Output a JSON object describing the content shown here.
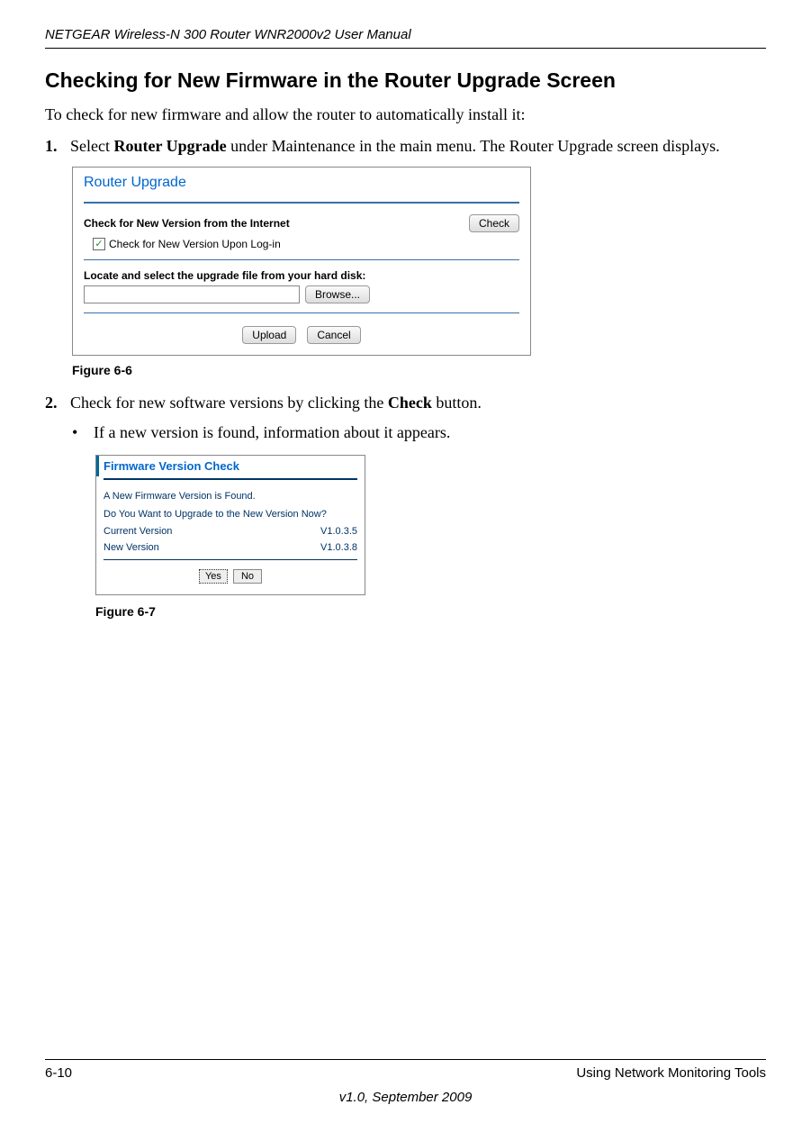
{
  "header": {
    "title": "NETGEAR Wireless-N 300 Router WNR2000v2 User Manual"
  },
  "section": {
    "heading": "Checking for New Firmware in the Router Upgrade Screen",
    "intro": "To check for new firmware and allow the router to automatically install it:"
  },
  "step1": {
    "num": "1.",
    "prefix": "Select ",
    "bold": "Router Upgrade",
    "suffix": " under Maintenance in the main menu. The Router Upgrade screen displays."
  },
  "screenshot1": {
    "title": "Router Upgrade",
    "check_label": "Check for New Version from the Internet",
    "check_btn": "Check",
    "checkbox_label": "Check for New Version Upon Log-in",
    "locate_label": "Locate and select the upgrade file from your hard disk:",
    "browse_btn": "Browse...",
    "upload_btn": "Upload",
    "cancel_btn": "Cancel"
  },
  "figure1": {
    "caption": "Figure 6-6"
  },
  "step2": {
    "num": "2.",
    "prefix": "Check for new software versions by clicking the ",
    "bold": "Check",
    "suffix": " button."
  },
  "bullet": {
    "dot": "•",
    "text": "If a new version is found, information about it appears."
  },
  "screenshot2": {
    "title": "Firmware Version Check",
    "line1": "A New Firmware Version is Found.",
    "line2": "Do You Want to Upgrade to the New Version Now?",
    "current_label": "Current Version",
    "current_val": "V1.0.3.5",
    "new_label": "New Version",
    "new_val": "V1.0.3.8",
    "yes_btn": "Yes",
    "no_btn": "No"
  },
  "figure2": {
    "caption": "Figure 6-7"
  },
  "footer": {
    "page": "6-10",
    "section": "Using Network Monitoring Tools",
    "version": "v1.0, September 2009"
  }
}
